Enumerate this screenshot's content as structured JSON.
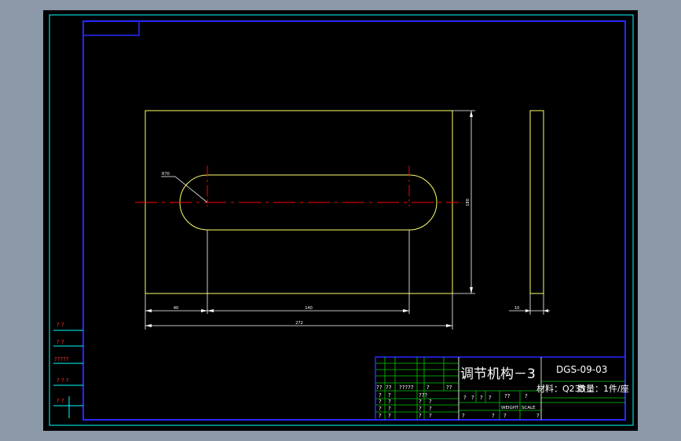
{
  "colors": {
    "background": "#8b98a8",
    "paper": "#000000",
    "border_cyan": "#00ffff",
    "frame_blue": "#2828ff",
    "part_yellow": "#ffff66",
    "dim_white": "#ffffff",
    "center_red": "#ff0000",
    "table_green": "#00cc00",
    "question_red": "#ff0000"
  },
  "drawing": {
    "radius_label": "R70",
    "dim_height": "180",
    "dim_thickness": "10",
    "dim_left": "40",
    "dim_slot": "140",
    "dim_total": "272"
  },
  "title_block": {
    "part_name": "调节机构－3",
    "drawing_no": "DGS-09-03",
    "material": "材料：Q235",
    "quantity": "数量：1件/座",
    "weight_label": "WEIGHT",
    "scale_label": "SCALE",
    "q1": "?",
    "q2": "??",
    "q3": "???",
    "q5": "?????"
  },
  "side_table": {
    "rows": [
      "? ?",
      "? ?",
      "?????",
      "? ? ?",
      "? ?"
    ]
  }
}
